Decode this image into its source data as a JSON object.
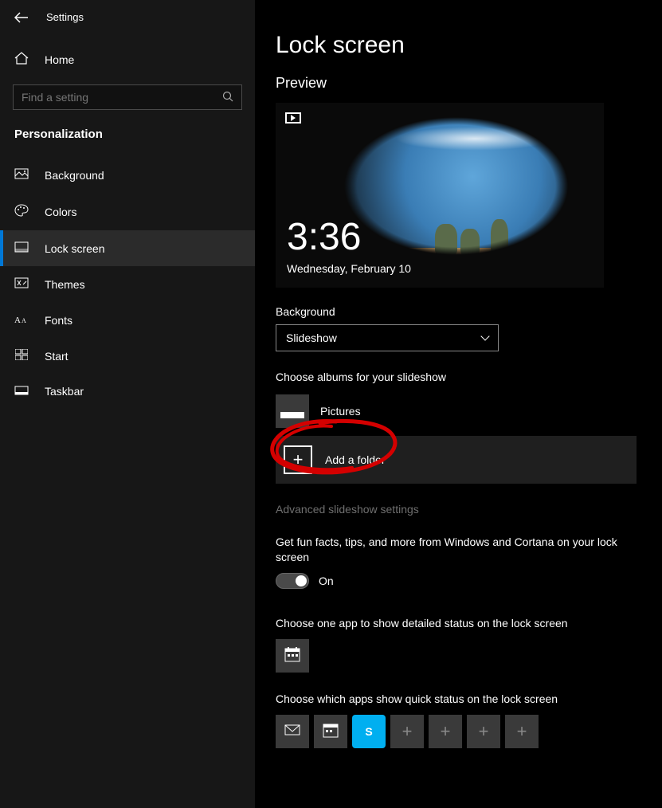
{
  "header": {
    "app_title": "Settings"
  },
  "sidebar": {
    "home": "Home",
    "search_placeholder": "Find a setting",
    "section": "Personalization",
    "items": [
      {
        "label": "Background"
      },
      {
        "label": "Colors"
      },
      {
        "label": "Lock screen"
      },
      {
        "label": "Themes"
      },
      {
        "label": "Fonts"
      },
      {
        "label": "Start"
      },
      {
        "label": "Taskbar"
      }
    ]
  },
  "page": {
    "title": "Lock screen",
    "preview_heading": "Preview",
    "preview_time": "3:36",
    "preview_date": "Wednesday, February 10",
    "bg_label": "Background",
    "bg_value": "Slideshow",
    "albums_label": "Choose albums for your slideshow",
    "album_name": "Pictures",
    "add_folder": "Add a folder",
    "advanced_link": "Advanced slideshow settings",
    "tips_label": "Get fun facts, tips, and more from Windows and Cortana on your lock screen",
    "tips_value": "On",
    "detailed_label": "Choose one app to show detailed status on the lock screen",
    "quick_label": "Choose which apps show quick status on the lock screen"
  }
}
